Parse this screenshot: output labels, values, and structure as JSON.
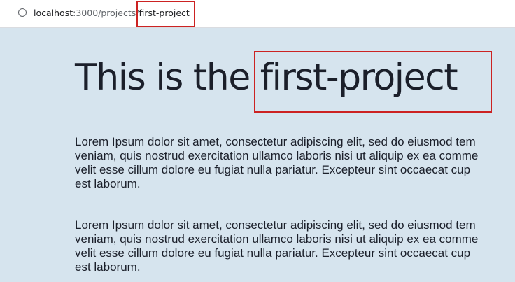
{
  "browser": {
    "url_host": "localhost",
    "url_path_prefix": ":3000/projects/",
    "url_path_highlight": "first-project"
  },
  "page": {
    "title_prefix": "This is the ",
    "title_highlight": "first-project",
    "paragraphs": [
      {
        "lines": [
          "Lorem Ipsum dolor sit amet, consectetur adipiscing elit, sed do eiusmod tem",
          "veniam, quis nostrud exercitation ullamco laboris nisi ut aliquip ex ea comme",
          "velit esse cillum dolore eu fugiat nulla pariatur. Excepteur sint occaecat cup",
          "est laborum."
        ]
      },
      {
        "lines": [
          "Lorem Ipsum dolor sit amet, consectetur adipiscing elit, sed do eiusmod tem",
          "veniam, quis nostrud exercitation ullamco laboris nisi ut aliquip ex ea comme",
          "velit esse cillum dolore eu fugiat nulla pariatur. Excepteur sint occaecat cup",
          "est laborum."
        ]
      }
    ]
  },
  "colors": {
    "page_background": "#d6e4ee",
    "highlight_border": "#cc2222",
    "text": "#1b1f2a"
  }
}
